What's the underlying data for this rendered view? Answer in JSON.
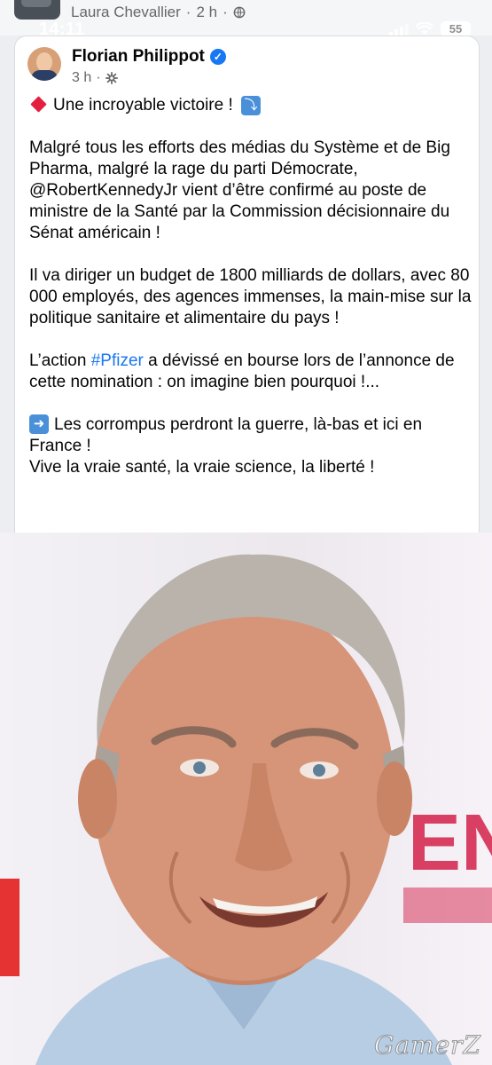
{
  "share_header": {
    "name": "Laura Chevallier",
    "time": "2 h",
    "separator": "·"
  },
  "status_bar": {
    "time": "14:11",
    "battery": "55"
  },
  "post": {
    "author": "Florian Philippot",
    "time": "3 h",
    "separator": "·",
    "line1": "Une incroyable victoire !",
    "paragraph2": "Malgré tous les efforts des médias du Système et de Big Pharma, malgré la rage du parti Démocrate, @RobertKennedyJr vient d’être confirmé au poste de ministre de la Santé par la Commission décisionnaire du Sénat américain !",
    "paragraph3": "Il va diriger un budget de 1800 milliards de dollars, avec 80 000 employés, des agences immenses, la main-mise sur la politique sanitaire et alimentaire du pays !",
    "paragraph4_before": "L’action ",
    "paragraph4_hashtag": "#Pfizer",
    "paragraph4_after": " a dévissé en bourse lors de l’annonce de cette nomination : on imagine bien pourquoi !...",
    "paragraph5_line1": "Les corrompus perdront la guerre, là-bas et ici en France !",
    "paragraph5_line2": "Vive la vraie santé, la vraie science, la liberté !"
  },
  "image": {
    "watermark": "GamerZ"
  }
}
